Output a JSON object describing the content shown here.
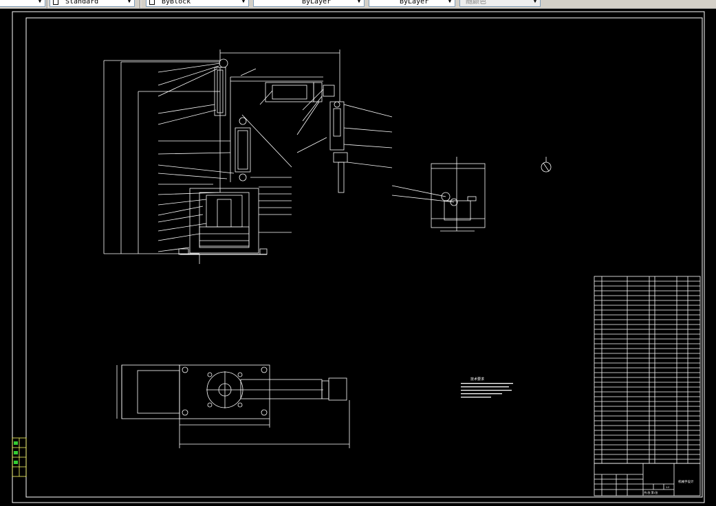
{
  "toolbar": {
    "text_style": "Standard",
    "color": "ByBlock",
    "linetype": "ByLayer",
    "lineweight": "ByLayer",
    "plot_style": "随颜色"
  },
  "drawing": {
    "title": "机械手设计",
    "sheet_info": "共1张 第1张",
    "scale": "1:2",
    "technical_requirements_title": "技术要求"
  },
  "colors": {
    "background": "#000000",
    "lines": "#ffffff",
    "toolbar": "#d4d0c8"
  }
}
